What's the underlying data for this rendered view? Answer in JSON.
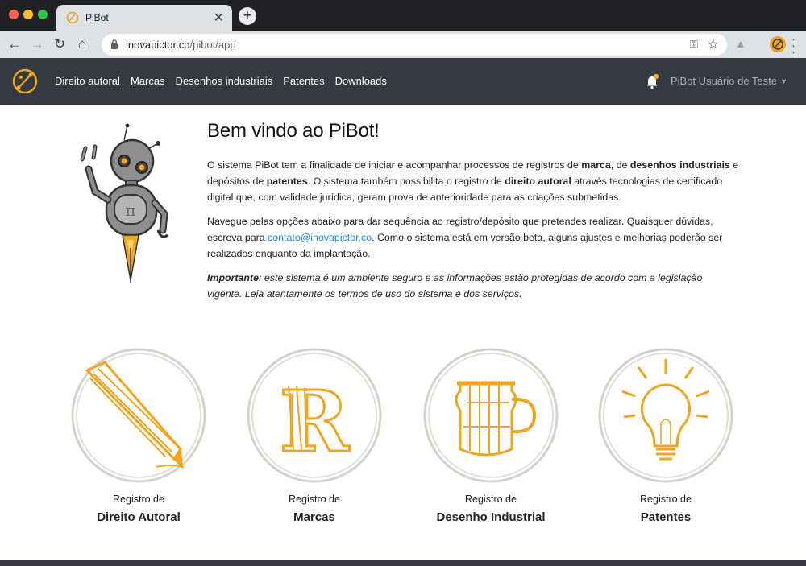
{
  "browser": {
    "tab_title": "PiBot",
    "tab_close": "✕",
    "new_tab": "+",
    "url_host": "inovapictor.co",
    "url_path": "/pibot/app"
  },
  "navbar": {
    "links": [
      "Direito autoral",
      "Marcas",
      "Desenhos industriais",
      "Patentes",
      "Downloads"
    ],
    "user": "PiBot Usuário de Teste",
    "notification_color": "#f5a623"
  },
  "welcome": {
    "title": "Bem vindo ao PiBot!",
    "p1": {
      "t1": "O sistema PiBot tem a finalidade de iniciar e acompanhar processos de registros de ",
      "b1": "marca",
      "t2": ", de ",
      "b2": "desenhos industriais",
      "t3": " e depósitos de ",
      "b3": "patentes",
      "t4": ". O sistema também possibilita o registro de ",
      "b4": "direito autoral",
      "t5": " através tecnologias de certificado digital que, com validade jurídica, geram prova de anterioridade para as criações submetidas."
    },
    "p2": {
      "t1": "Navegue pelas opções abaixo para dar sequência ao registro/depósito que pretendes realizar. Quaisquer dúvidas, escreva para ",
      "link": "contato@inovapictor.co",
      "t2": ". Como o sistema está em versão beta, alguns ajustes e melhorias poderão ser realizados enquanto da implantação."
    },
    "p3": {
      "b1": "Importante",
      "t1": ": este sistema é um ambiente seguro e as informações estão protegidas de acordo com a legislação vigente. Leia atentamente os termos de uso do sistema e dos serviços."
    }
  },
  "cards": [
    {
      "sub": "Registro de",
      "title": "Direito Autoral",
      "icon": "pen-icon"
    },
    {
      "sub": "Registro de",
      "title": "Marcas",
      "icon": "letter-r-icon"
    },
    {
      "sub": "Registro de",
      "title": "Desenho Industrial",
      "icon": "mug-icon"
    },
    {
      "sub": "Registro de",
      "title": "Patentes",
      "icon": "lightbulb-icon"
    }
  ],
  "colors": {
    "accent": "#f0a521",
    "navbar": "#343a40",
    "link": "#1e88e5",
    "circle": "#d4d2c9"
  }
}
